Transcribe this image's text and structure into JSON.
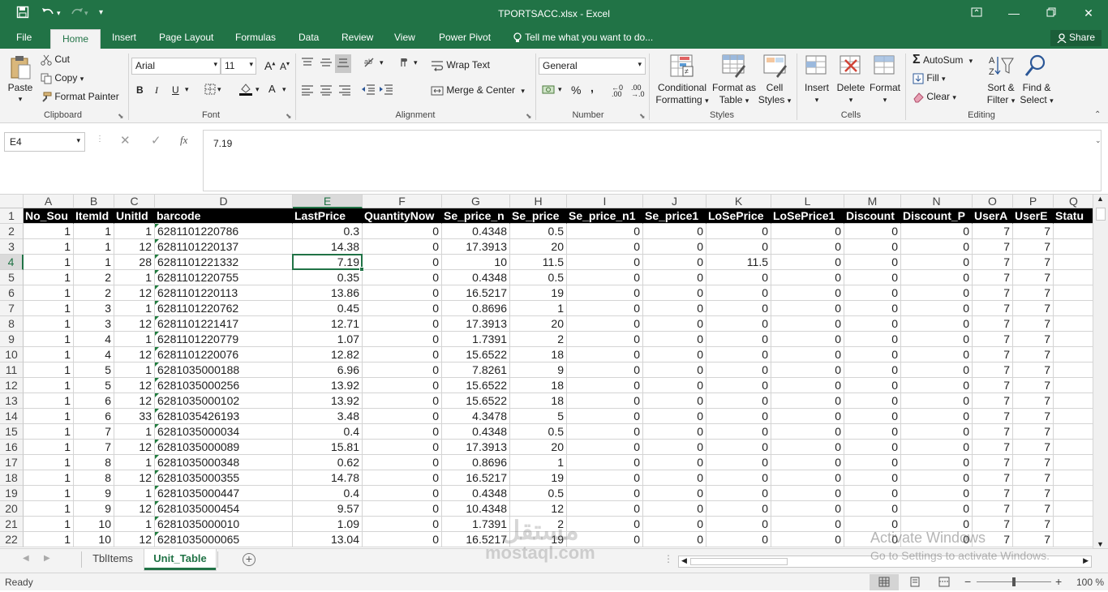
{
  "window": {
    "title": "TPORTSACC.xlsx - Excel"
  },
  "quick_access": [
    "save-icon",
    "undo-icon",
    "redo-icon",
    "customize-icon"
  ],
  "ribbon_tabs": [
    "File",
    "Home",
    "Insert",
    "Page Layout",
    "Formulas",
    "Data",
    "Review",
    "View",
    "Power Pivot"
  ],
  "active_tab": "Home",
  "tell_me": "Tell me what you want to do...",
  "share_label": "Share",
  "clipboard": {
    "paste": "Paste",
    "cut": "Cut",
    "copy": "Copy",
    "format_painter": "Format Painter",
    "label": "Clipboard"
  },
  "font": {
    "name": "Arial",
    "size": "11",
    "label": "Font"
  },
  "alignment": {
    "wrap": "Wrap Text",
    "merge": "Merge & Center",
    "label": "Alignment"
  },
  "number": {
    "format": "General",
    "label": "Number"
  },
  "styles": {
    "conditional": "Conditional",
    "conditional2": "Formatting",
    "format_as": "Format as",
    "format_as2": "Table",
    "cell": "Cell",
    "cell2": "Styles",
    "label": "Styles"
  },
  "cells": {
    "insert": "Insert",
    "delete": "Delete",
    "format": "Format",
    "label": "Cells"
  },
  "editing": {
    "autosum": "AutoSum",
    "fill": "Fill",
    "clear": "Clear",
    "sort": "Sort &",
    "sort2": "Filter",
    "find": "Find &",
    "find2": "Select",
    "label": "Editing"
  },
  "formula_bar": {
    "name_box": "E4",
    "fx": "fx",
    "value": "7.19"
  },
  "columns": [
    "A",
    "B",
    "C",
    "D",
    "E",
    "F",
    "G",
    "H",
    "I",
    "J",
    "K",
    "L",
    "M",
    "N",
    "O",
    "P",
    "Q"
  ],
  "selected_cell": {
    "col": "E",
    "row": "4"
  },
  "header_row": [
    "No_Sou",
    "ItemId",
    "UnitId",
    "barcode",
    "LastPrice",
    "QuantityNow",
    "Se_price_n",
    "Se_price",
    "Se_price_n1",
    "Se_price1",
    "LoSePrice",
    "LoSePrice1",
    "Discount",
    "Discount_P",
    "UserA",
    "UserE",
    "Statu"
  ],
  "rows": [
    [
      "1",
      "1",
      "1",
      "6281101220786",
      "0.3",
      "0",
      "0.4348",
      "0.5",
      "0",
      "0",
      "0",
      "0",
      "0",
      "0",
      "7",
      "7"
    ],
    [
      "1",
      "1",
      "12",
      "6281101220137",
      "14.38",
      "0",
      "17.3913",
      "20",
      "0",
      "0",
      "0",
      "0",
      "0",
      "0",
      "7",
      "7"
    ],
    [
      "1",
      "1",
      "28",
      "6281101221332",
      "7.19",
      "0",
      "10",
      "11.5",
      "0",
      "0",
      "11.5",
      "0",
      "0",
      "0",
      "7",
      "7"
    ],
    [
      "1",
      "2",
      "1",
      "6281101220755",
      "0.35",
      "0",
      "0.4348",
      "0.5",
      "0",
      "0",
      "0",
      "0",
      "0",
      "0",
      "7",
      "7"
    ],
    [
      "1",
      "2",
      "12",
      "6281101220113",
      "13.86",
      "0",
      "16.5217",
      "19",
      "0",
      "0",
      "0",
      "0",
      "0",
      "0",
      "7",
      "7"
    ],
    [
      "1",
      "3",
      "1",
      "6281101220762",
      "0.45",
      "0",
      "0.8696",
      "1",
      "0",
      "0",
      "0",
      "0",
      "0",
      "0",
      "7",
      "7"
    ],
    [
      "1",
      "3",
      "12",
      "6281101221417",
      "12.71",
      "0",
      "17.3913",
      "20",
      "0",
      "0",
      "0",
      "0",
      "0",
      "0",
      "7",
      "7"
    ],
    [
      "1",
      "4",
      "1",
      "6281101220779",
      "1.07",
      "0",
      "1.7391",
      "2",
      "0",
      "0",
      "0",
      "0",
      "0",
      "0",
      "7",
      "7"
    ],
    [
      "1",
      "4",
      "12",
      "6281101220076",
      "12.82",
      "0",
      "15.6522",
      "18",
      "0",
      "0",
      "0",
      "0",
      "0",
      "0",
      "7",
      "7"
    ],
    [
      "1",
      "5",
      "1",
      "6281035000188",
      "6.96",
      "0",
      "7.8261",
      "9",
      "0",
      "0",
      "0",
      "0",
      "0",
      "0",
      "7",
      "7"
    ],
    [
      "1",
      "5",
      "12",
      "6281035000256",
      "13.92",
      "0",
      "15.6522",
      "18",
      "0",
      "0",
      "0",
      "0",
      "0",
      "0",
      "7",
      "7"
    ],
    [
      "1",
      "6",
      "12",
      "6281035000102",
      "13.92",
      "0",
      "15.6522",
      "18",
      "0",
      "0",
      "0",
      "0",
      "0",
      "0",
      "7",
      "7"
    ],
    [
      "1",
      "6",
      "33",
      "6281035426193",
      "3.48",
      "0",
      "4.3478",
      "5",
      "0",
      "0",
      "0",
      "0",
      "0",
      "0",
      "7",
      "7"
    ],
    [
      "1",
      "7",
      "1",
      "6281035000034",
      "0.4",
      "0",
      "0.4348",
      "0.5",
      "0",
      "0",
      "0",
      "0",
      "0",
      "0",
      "7",
      "7"
    ],
    [
      "1",
      "7",
      "12",
      "6281035000089",
      "15.81",
      "0",
      "17.3913",
      "20",
      "0",
      "0",
      "0",
      "0",
      "0",
      "0",
      "7",
      "7"
    ],
    [
      "1",
      "8",
      "1",
      "6281035000348",
      "0.62",
      "0",
      "0.8696",
      "1",
      "0",
      "0",
      "0",
      "0",
      "0",
      "0",
      "7",
      "7"
    ],
    [
      "1",
      "8",
      "12",
      "6281035000355",
      "14.78",
      "0",
      "16.5217",
      "19",
      "0",
      "0",
      "0",
      "0",
      "0",
      "0",
      "7",
      "7"
    ],
    [
      "1",
      "9",
      "1",
      "6281035000447",
      "0.4",
      "0",
      "0.4348",
      "0.5",
      "0",
      "0",
      "0",
      "0",
      "0",
      "0",
      "7",
      "7"
    ],
    [
      "1",
      "9",
      "12",
      "6281035000454",
      "9.57",
      "0",
      "10.4348",
      "12",
      "0",
      "0",
      "0",
      "0",
      "0",
      "0",
      "7",
      "7"
    ],
    [
      "1",
      "10",
      "1",
      "6281035000010",
      "1.09",
      "0",
      "1.7391",
      "2",
      "0",
      "0",
      "0",
      "0",
      "0",
      "0",
      "7",
      "7"
    ],
    [
      "1",
      "10",
      "12",
      "6281035000065",
      "13.04",
      "0",
      "16.5217",
      "19",
      "0",
      "0",
      "0",
      "0",
      "0",
      "0",
      "7",
      "7"
    ]
  ],
  "sheets": [
    "TblItems",
    "Unit_Table"
  ],
  "active_sheet": "Unit_Table",
  "status": {
    "text": "Ready",
    "zoom": "100 %"
  },
  "overlay": {
    "activate": "Activate Windows",
    "activate_sub": "Go to Settings to activate Windows.",
    "logo_ar": "مستقل",
    "logo_en": "mostaql.com"
  },
  "colors": {
    "brand": "#217346",
    "header_fill": "#000000"
  }
}
